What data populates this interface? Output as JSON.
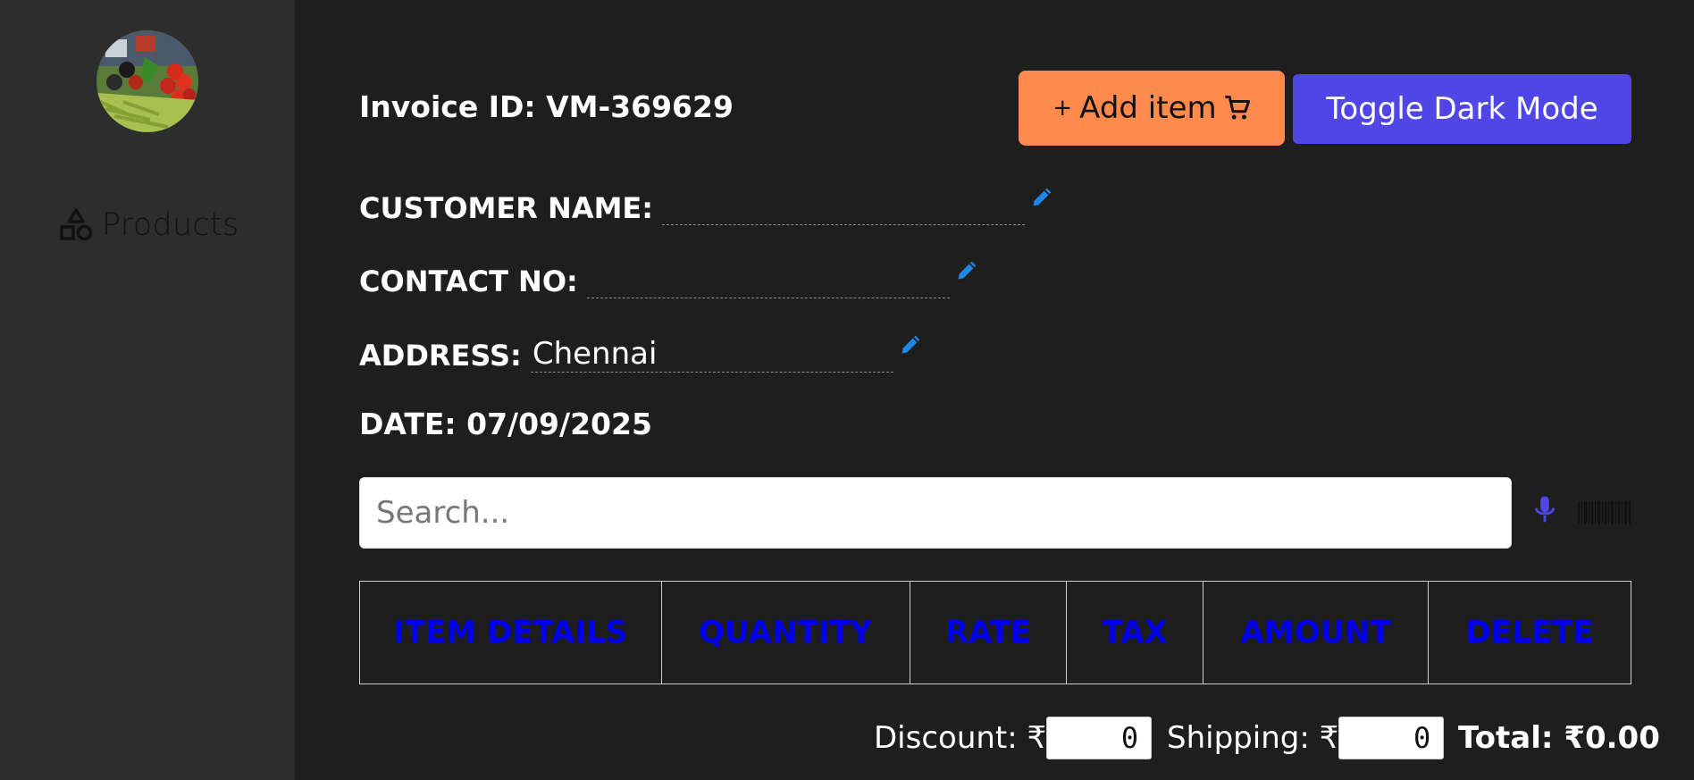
{
  "sidebar": {
    "nav_items": [
      {
        "label": "Products",
        "icon": "shapes-icon"
      }
    ]
  },
  "header": {
    "invoice_label": "Invoice ID:",
    "invoice_id": "VM-369629",
    "add_item_plus": "+",
    "add_item_label": "Add item",
    "toggle_dark_label": "Toggle Dark Mode"
  },
  "customer": {
    "name_label": "CUSTOMER NAME:",
    "name_value": "",
    "contact_label": "CONTACT NO:",
    "contact_value": "",
    "address_label": "ADDRESS:",
    "address_value": "Chennai",
    "date_label": "DATE:",
    "date_value": "07/09/2025"
  },
  "search": {
    "placeholder": "Search..."
  },
  "table": {
    "headers": [
      "ITEM DETAILS",
      "QUANTITY",
      "RATE",
      "TAX",
      "AMOUNT",
      "DELETE"
    ],
    "rows": []
  },
  "summary": {
    "discount_label": "Discount: ₹",
    "discount_value": "0",
    "shipping_label": "Shipping: ₹",
    "shipping_value": "0",
    "total_label": "Total: ₹0.00"
  },
  "colors": {
    "background": "#1e1e1e",
    "sidebar": "#2d2d2d",
    "add_button": "#ff8a4b",
    "dark_mode_button": "#4f46e5",
    "pencil": "#1e88e5",
    "table_header_text": "#0000ee"
  }
}
